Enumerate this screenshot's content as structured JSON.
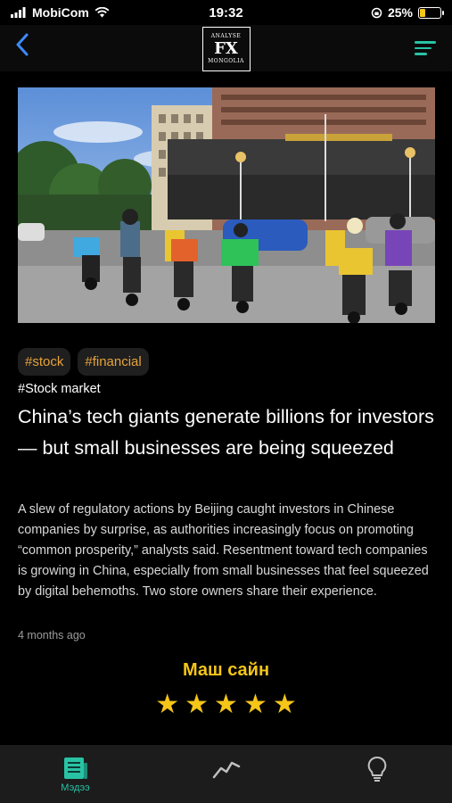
{
  "status_bar": {
    "carrier": "MobiCom",
    "time": "19:32",
    "battery_percent": "25%",
    "battery_level": 0.25,
    "battery_color": "#f5c518"
  },
  "header": {
    "logo_top": "ANALYSE",
    "logo_main": "FX",
    "logo_bottom": "MONGOLIA",
    "back_icon": "chevron-left-icon",
    "menu_icon": "hamburger-menu-icon",
    "accent_color": "#28c3a5"
  },
  "article": {
    "tags": [
      "#stock",
      "#financial"
    ],
    "category": "#Stock market",
    "title": "China’s tech giants generate billions for investors — but small businesses are being squeezed",
    "summary": "A slew of regulatory actions by Beijing caught investors in Chinese companies by surprise, as authorities increasingly focus on promoting “common prosperity,” analysts said. Resentment toward tech companies is growing in China, especially from small businesses that feel squeezed by digital behemoths. Two store owners share their experience.",
    "timestamp": "4 months ago"
  },
  "rating": {
    "label": "Маш сайн",
    "stars": 5,
    "max_stars": 5,
    "star_color": "#f5c518"
  },
  "bottom_nav": {
    "items": [
      {
        "label": "Мэдээ",
        "icon": "news-icon",
        "active": true
      },
      {
        "label": "",
        "icon": "chart-line-icon",
        "active": false
      },
      {
        "label": "",
        "icon": "lightbulb-icon",
        "active": false
      }
    ]
  }
}
